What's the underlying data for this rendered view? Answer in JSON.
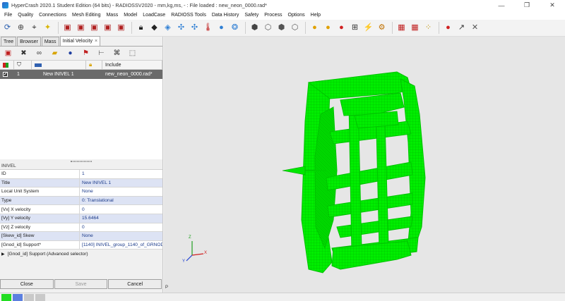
{
  "window": {
    "title": "HyperCrash 2020.1 Student Edition (64 bits) - RADIOSSV2020 - mm,kg,ms, - : File loaded : new_neon_0000.rad*",
    "controls": [
      "—",
      "❐",
      "✕"
    ]
  },
  "menu": [
    "File",
    "Quality",
    "Connections",
    "Mesh Editing",
    "Mass",
    "Model",
    "LoadCase",
    "RADIOSS Tools",
    "Data History",
    "Safety",
    "Process",
    "Options",
    "Help"
  ],
  "tabs": [
    {
      "label": "Tree"
    },
    {
      "label": "Browser"
    },
    {
      "label": "Mass"
    },
    {
      "label": "Initial Velocity",
      "close": "×"
    }
  ],
  "list": {
    "headers": [
      "",
      "",
      "",
      "",
      "Include"
    ],
    "rows": [
      {
        "id": "1",
        "name": "New INIVEL 1",
        "include": "new_neon_0000.rad*"
      }
    ]
  },
  "properties": {
    "title": "INIVEL",
    "rows": [
      {
        "key": "ID",
        "value": "1"
      },
      {
        "key": "Title",
        "value": "New INIVEL 1"
      },
      {
        "key": "Local Unit System",
        "value": "None"
      },
      {
        "key": "Type",
        "value": "0: Translational"
      },
      {
        "key": "[Vx] X velocity",
        "value": "0"
      },
      {
        "key": "[Vy] Y velocity",
        "value": "15.6464"
      },
      {
        "key": "[Vz] Z velocity",
        "value": "0"
      },
      {
        "key": "[Skew_id] Skew",
        "value": "None"
      },
      {
        "key": "[Gnod_id] Support*",
        "value": "[1140] INIVEL_group_1140_of_GRNOD"
      }
    ],
    "advanced": "[Gnod_id] Support (Advanced selector)"
  },
  "buttons": {
    "close": "Close",
    "save": "Save",
    "cancel": "Cancel"
  },
  "viewport": {
    "background": "#e6e6e6",
    "mesh_color": "#00ee00",
    "axis": {
      "x": "X",
      "y": "Y",
      "z": "Z"
    },
    "corner_label": "P"
  },
  "status_colors": [
    "#22dd22",
    "#5b7fe0",
    "#c9c9c9",
    "#c9c9c9"
  ]
}
